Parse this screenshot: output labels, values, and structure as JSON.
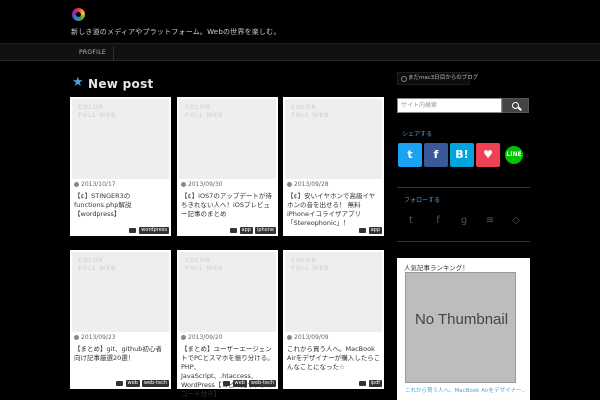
{
  "header": {
    "tagline": "新しき道のメディアやプラットフォーム。Webの世界を楽しむ。",
    "nav": {
      "profile": "PROFILE"
    }
  },
  "main": {
    "section_title": "New post",
    "thumb_placeholder": "COLOR FULL WEB",
    "posts": [
      {
        "date": "2013/10/17",
        "title": "【¢】STINGER3の functions.php解説 【wordpress】",
        "tags": [
          "wordpress"
        ]
      },
      {
        "date": "2013/09/30",
        "title": "【¢】iOS7のアップデートが待ちきれない人へ！iOSプレビュー記事のまとめ",
        "tags": [
          "app",
          "iphone"
        ]
      },
      {
        "date": "2013/09/28",
        "title": "【¢】安いイヤホンで高級イヤホンの音を出せる！ 無料iPhoneイコライザアプリ「Stereophonic」！",
        "tags": [
          "app"
        ]
      },
      {
        "date": "2013/09/23",
        "title": "【まとめ】git、github初心者向け記事厳選20選！",
        "tags": [
          "web",
          "web-tech"
        ]
      },
      {
        "date": "2013/09/20",
        "title": "【まとめ】ユーザーエージェントでPCとスマホを振り分ける。PHP、JavaScript、.htaccess、WordPress【コピペ用サンプルコード付き】",
        "tags": [
          "web",
          "web-tech"
        ]
      },
      {
        "date": "2013/09/09",
        "title": "これから買う人へ。MacBook Airをデザイナーが購入したらこんなことになった☆",
        "tags": [
          "ipdf"
        ]
      }
    ]
  },
  "sidebar": {
    "header_widget": "まだmac3日目からのブログ",
    "search": {
      "placeholder": "サイト内検索"
    },
    "share_label": "シェアする",
    "share_buttons": [
      {
        "name": "twitter",
        "glyph": "t",
        "color": "#1da1f2"
      },
      {
        "name": "facebook",
        "glyph": "f",
        "color": "#3b5998"
      },
      {
        "name": "hatena",
        "glyph": "B!",
        "color": "#00a4de"
      },
      {
        "name": "pocket",
        "glyph": "♥",
        "color": "#ef4056"
      },
      {
        "name": "line",
        "glyph": "LINE",
        "color": "#00c300"
      }
    ],
    "follow_label": "フォローする",
    "ranking_title": "人気記事ランキング！",
    "ranking_thumb_text": "No Thumbnail",
    "ranking_caption": "これから買う人へ。MacBook Airをデザイナー..."
  }
}
